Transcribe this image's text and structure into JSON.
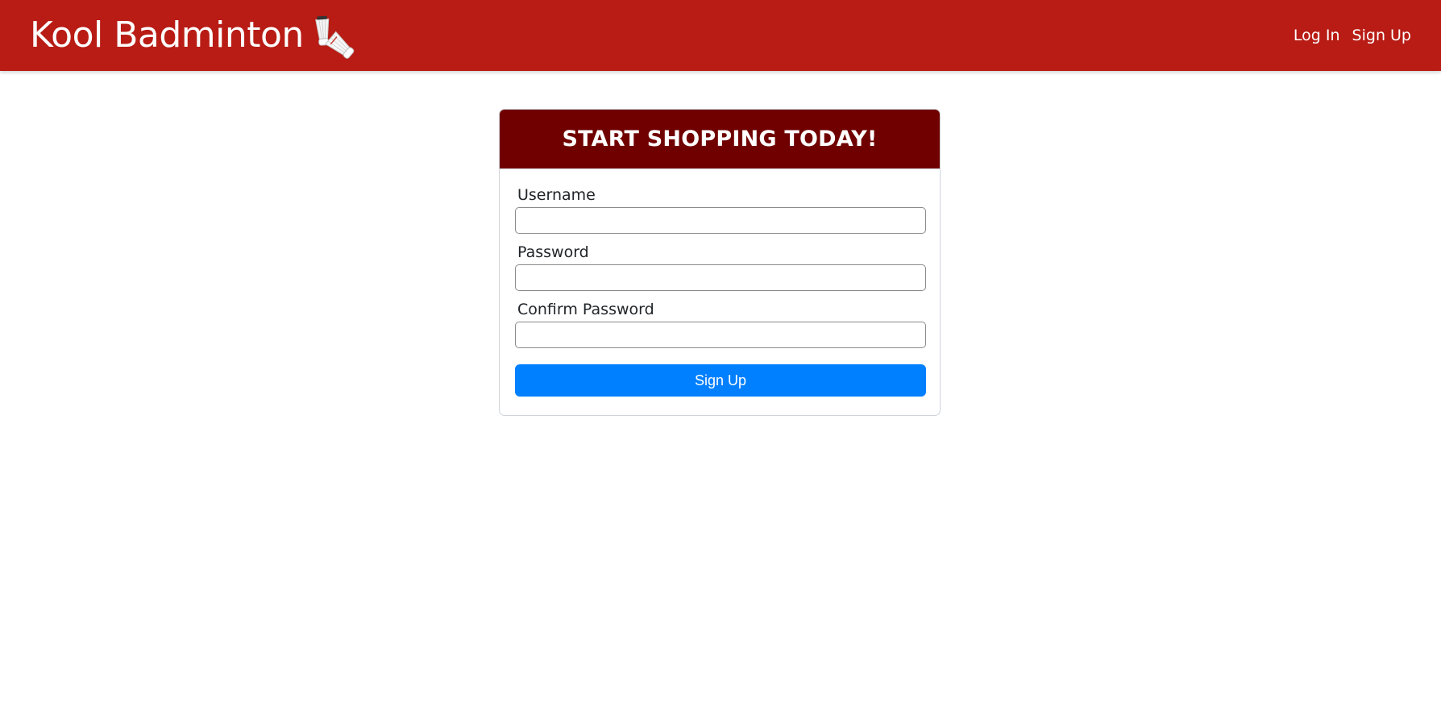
{
  "navbar": {
    "brand": "Kool Badminton",
    "logo_icon": "shuttlecock-icon",
    "background_color": "#b81c15",
    "links": [
      {
        "label": "Log In"
      },
      {
        "label": "Sign Up"
      }
    ]
  },
  "signup_card": {
    "title": "START SHOPPING TODAY!",
    "header_color": "#700000",
    "fields": [
      {
        "label": "Username",
        "value": ""
      },
      {
        "label": "Password",
        "value": ""
      },
      {
        "label": "Confirm Password",
        "value": ""
      }
    ],
    "submit_label": "Sign Up",
    "submit_color": "#0080ff"
  }
}
